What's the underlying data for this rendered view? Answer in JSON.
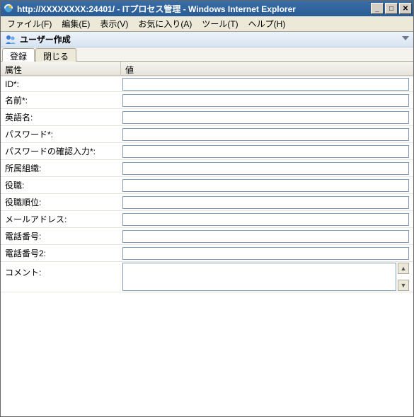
{
  "window": {
    "title": "http://XXXXXXXX:24401/ - ITプロセス管理 - Windows Internet Explorer"
  },
  "menubar": {
    "file": "ファイル(F)",
    "edit": "編集(E)",
    "view": "表示(V)",
    "fav": "お気に入り(A)",
    "tools": "ツール(T)",
    "help": "ヘルプ(H)"
  },
  "page": {
    "title": "ユーザー作成"
  },
  "tabs": {
    "register": "登録",
    "close": "閉じる"
  },
  "grid": {
    "attr_header": "属性",
    "val_header": "値"
  },
  "fields": {
    "id": {
      "label": "ID*:",
      "value": ""
    },
    "name": {
      "label": "名前*:",
      "value": ""
    },
    "en_name": {
      "label": "英語名:",
      "value": ""
    },
    "password": {
      "label": "パスワード*:",
      "value": ""
    },
    "password2": {
      "label": "パスワードの確認入力*:",
      "value": ""
    },
    "org": {
      "label": "所属組織:",
      "value": ""
    },
    "title": {
      "label": "役職:",
      "value": ""
    },
    "rank": {
      "label": "役職順位:",
      "value": ""
    },
    "email": {
      "label": "メールアドレス:",
      "value": ""
    },
    "phone1": {
      "label": "電話番号:",
      "value": ""
    },
    "phone2": {
      "label": "電話番号2:",
      "value": ""
    },
    "comment": {
      "label": "コメント:",
      "value": ""
    }
  }
}
